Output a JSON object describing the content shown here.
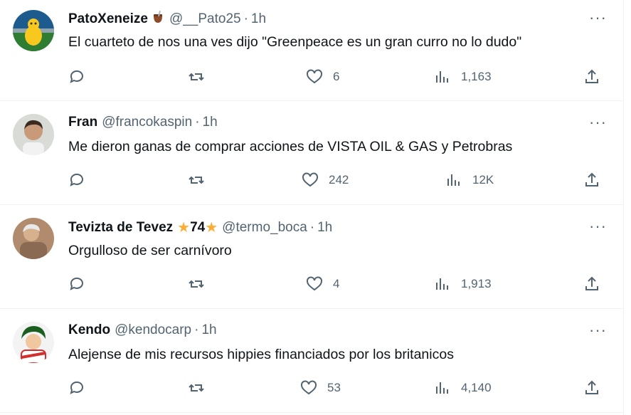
{
  "tweets": [
    {
      "name": "PatoXeneize",
      "handle": "@__Pato25",
      "time": "1h",
      "text": "El cuarteto de nos una ves dijo \"Greenpeace es un gran curro no lo dudo\"",
      "likes": "6",
      "views": "1,163",
      "badge": "mate-icon"
    },
    {
      "name": "Fran",
      "handle": "@francokaspin",
      "time": "1h",
      "text": "Me dieron ganas de comprar acciones de VISTA OIL & GAS y Petrobras",
      "likes": "242",
      "views": "12K"
    },
    {
      "name": "Tevizta de Tevez",
      "name_suffix": "74",
      "handle": "@termo_boca",
      "time": "1h",
      "text": "Orgulloso de ser carnívoro",
      "likes": "4",
      "views": "1,913"
    },
    {
      "name": "Kendo",
      "handle": "@kendocarp",
      "time": "1h",
      "text": "Alejense de mis recursos hippies financiados por los britanicos",
      "likes": "53",
      "views": "4,140"
    }
  ],
  "separator": "·",
  "more_label": "···",
  "colors": {
    "text": "#0f1419",
    "muted": "#536471",
    "border": "#eff3f4",
    "star": "#ffac33"
  }
}
